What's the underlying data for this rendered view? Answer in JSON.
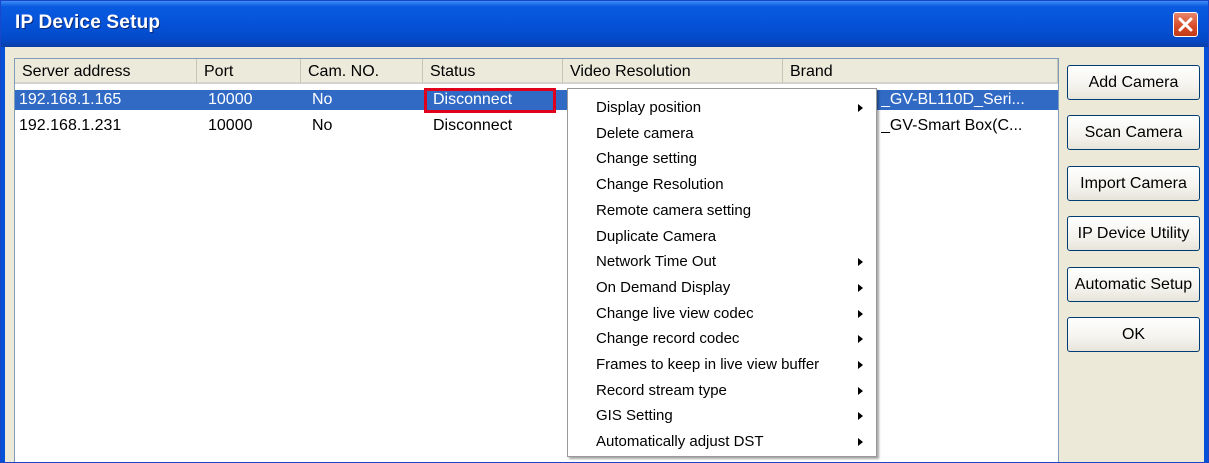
{
  "window": {
    "title": "IP Device Setup"
  },
  "table": {
    "columns": [
      "Server address",
      "Port",
      "Cam. NO.",
      "Status",
      "Video Resolution",
      "Brand"
    ],
    "rows": [
      {
        "server": "192.168.1.165",
        "port": "10000",
        "cam": "No",
        "status": "Disconnect",
        "resolution": "",
        "brand": "_GV-BL110D_Seri...",
        "selected": true
      },
      {
        "server": "192.168.1.231",
        "port": "10000",
        "cam": "No",
        "status": "Disconnect",
        "resolution": "",
        "brand": "_GV-Smart Box(C...",
        "selected": false
      }
    ]
  },
  "buttons": {
    "add_camera": "Add Camera",
    "scan_camera": "Scan Camera",
    "import_camera": "Import Camera",
    "ip_device_utility": "IP Device Utility",
    "automatic_setup": "Automatic Setup",
    "ok": "OK"
  },
  "context_menu": {
    "items": [
      {
        "label": "Display position",
        "submenu": true
      },
      {
        "label": "Delete camera",
        "submenu": false
      },
      {
        "label": "Change setting",
        "submenu": false
      },
      {
        "label": "Change Resolution",
        "submenu": false
      },
      {
        "label": "Remote camera setting",
        "submenu": false
      },
      {
        "label": "Duplicate Camera",
        "submenu": false
      },
      {
        "label": "Network Time Out",
        "submenu": true
      },
      {
        "label": "On Demand Display",
        "submenu": true
      },
      {
        "label": "Change live view codec",
        "submenu": true
      },
      {
        "label": "Change record codec",
        "submenu": true
      },
      {
        "label": "Frames to keep in live view buffer",
        "submenu": true
      },
      {
        "label": "Record stream type",
        "submenu": true
      },
      {
        "label": "GIS Setting",
        "submenu": true
      },
      {
        "label": "Automatically adjust DST",
        "submenu": true
      }
    ]
  },
  "colors": {
    "titlebar": "#0552d8",
    "selection": "#316ac5",
    "highlight_box": "#e0001b",
    "close_button": "#d64a26"
  },
  "icons": {
    "close": "close-icon",
    "submenu": "submenu-arrow-icon"
  }
}
